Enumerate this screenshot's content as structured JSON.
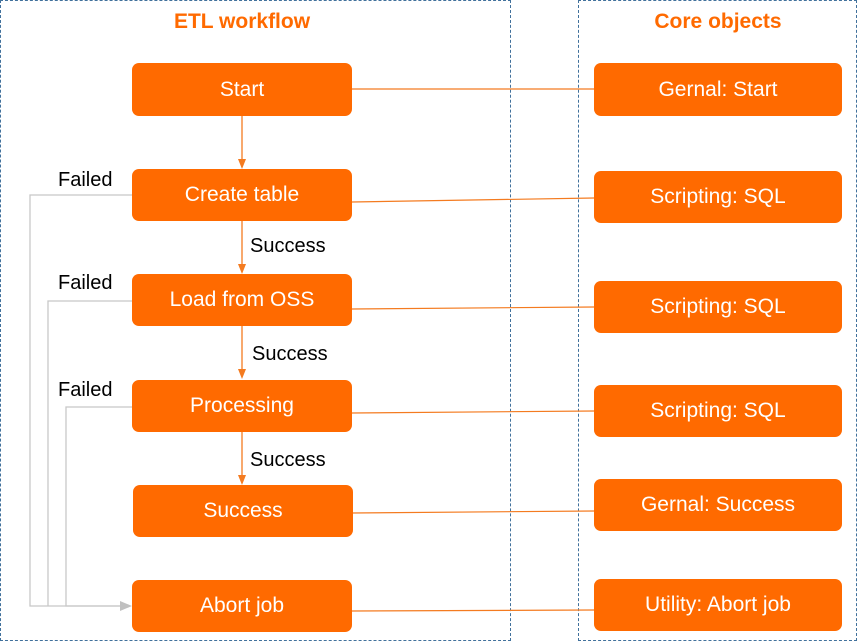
{
  "colors": {
    "node_fill": "#ff6a00",
    "node_text": "#ffffff",
    "title": "#ff6a00",
    "frame_border": "#41719c",
    "success_arrow": "#f47b20",
    "failed_arrow": "#c0c0c0",
    "link": "#f47b20"
  },
  "workflow": {
    "title": "ETL workflow",
    "nodes": [
      {
        "id": "start",
        "label": "Start"
      },
      {
        "id": "create_table",
        "label": "Create table"
      },
      {
        "id": "load_from_oss",
        "label": "Load from OSS"
      },
      {
        "id": "processing",
        "label": "Processing"
      },
      {
        "id": "success",
        "label": "Success"
      },
      {
        "id": "abort_job",
        "label": "Abort job"
      }
    ],
    "edges": [
      {
        "from": "start",
        "to": "create_table",
        "label": ""
      },
      {
        "from": "create_table",
        "to": "load_from_oss",
        "label": "Success"
      },
      {
        "from": "load_from_oss",
        "to": "processing",
        "label": "Success"
      },
      {
        "from": "processing",
        "to": "success",
        "label": "Success"
      },
      {
        "from": "create_table",
        "to": "abort_job",
        "label": "Failed"
      },
      {
        "from": "load_from_oss",
        "to": "abort_job",
        "label": "Failed"
      },
      {
        "from": "processing",
        "to": "abort_job",
        "label": "Failed"
      }
    ]
  },
  "core_objects": {
    "title": "Core objects",
    "nodes": [
      {
        "id": "gernal_start",
        "label": "Gernal: Start",
        "maps_to": "start"
      },
      {
        "id": "scripting_sql_1",
        "label": "Scripting: SQL",
        "maps_to": "create_table"
      },
      {
        "id": "scripting_sql_2",
        "label": "Scripting: SQL",
        "maps_to": "load_from_oss"
      },
      {
        "id": "scripting_sql_3",
        "label": "Scripting: SQL",
        "maps_to": "processing"
      },
      {
        "id": "gernal_success",
        "label": "Gernal: Success",
        "maps_to": "success"
      },
      {
        "id": "utility_abort_job",
        "label": "Utility: Abort job",
        "maps_to": "abort_job"
      }
    ]
  }
}
